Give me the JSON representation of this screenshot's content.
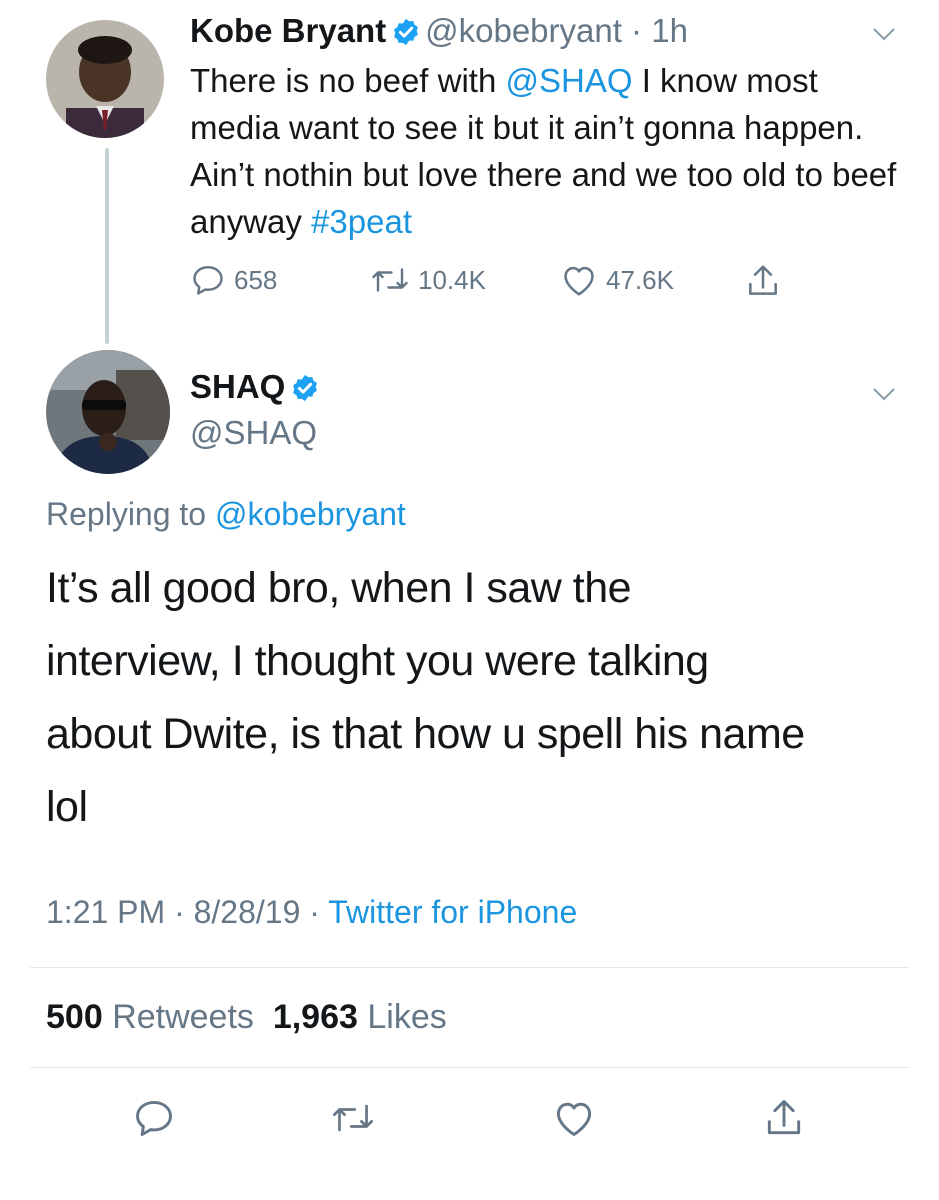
{
  "parent_tweet": {
    "name": "Kobe Bryant",
    "handle": "@kobebryant",
    "time": "1h",
    "text_before": "There is no beef with ",
    "mention": "@SHAQ",
    "text_middle": " I know most media want to see it but it ain’t gonna happen. Ain’t nothin but love there and we too old to beef anyway ",
    "hashtag": "#3peat",
    "replies": "658",
    "retweets": "10.4K",
    "likes": "47.6K"
  },
  "reply_tweet": {
    "name": "SHAQ",
    "handle": "@SHAQ",
    "replying_label": "Replying to",
    "replying_to": "@kobebryant",
    "text": "It’s all good bro, when I saw the interview, I thought you were talking about Dwite, is that how u spell his name lol",
    "time": "1:21 PM",
    "date": "8/28/19",
    "source": "Twitter for iPhone",
    "retweet_count": "500",
    "retweet_label": "Retweets",
    "like_count": "1,963",
    "like_label": "Likes"
  },
  "colors": {
    "link_blue": "#1b95e0",
    "gray_text": "#657786",
    "divider": "#e1e8ed"
  },
  "icons": [
    "verified-badge-icon",
    "chevron-down-icon",
    "reply-icon",
    "retweet-icon",
    "like-icon",
    "share-icon"
  ]
}
